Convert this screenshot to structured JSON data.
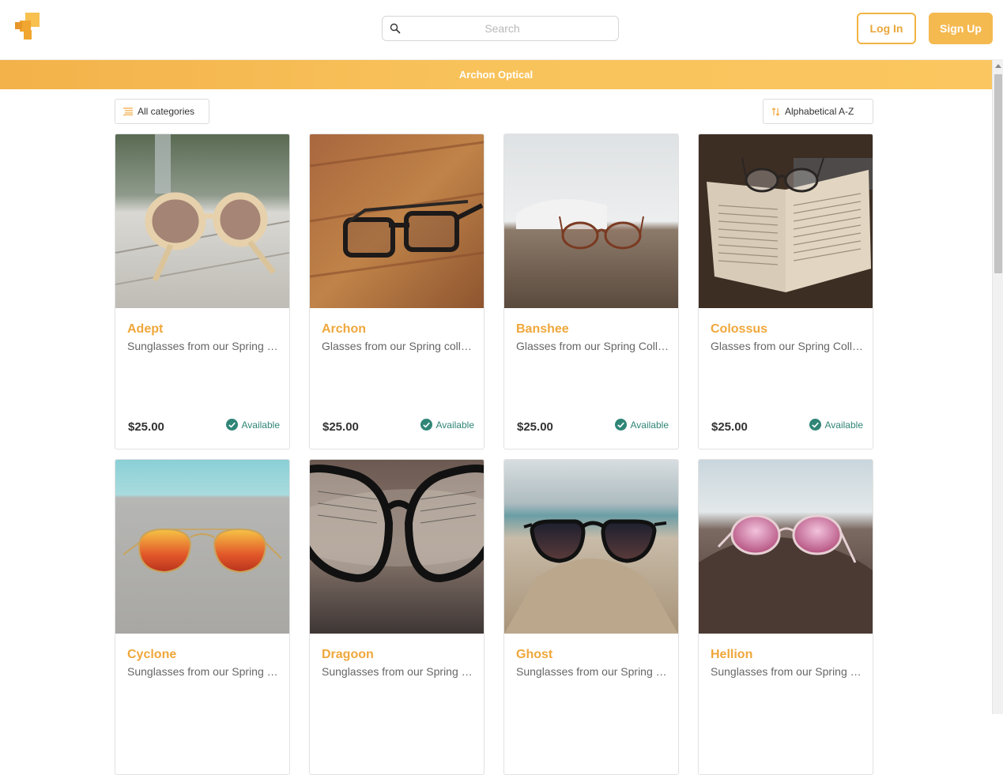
{
  "header": {
    "logo_icon": "logo-icon",
    "search": {
      "placeholder": "Search",
      "value": ""
    },
    "login_label": "Log In",
    "signup_label": "Sign Up"
  },
  "banner": {
    "title": "Archon Optical"
  },
  "filters": {
    "category_label": "All categories",
    "sort_label": "Alphabetical A-Z"
  },
  "colors": {
    "accent": "#f4b94f",
    "accent_text": "#efa73b",
    "available": "#2f8576"
  },
  "products": [
    {
      "name": "Adept",
      "description": "Sunglasses from our Spring collection",
      "price": "$25.00",
      "status": "Available"
    },
    {
      "name": "Archon",
      "description": "Glasses from our Spring collection",
      "price": "$25.00",
      "status": "Available"
    },
    {
      "name": "Banshee",
      "description": "Glasses from our Spring Collection",
      "price": "$25.00",
      "status": "Available"
    },
    {
      "name": "Colossus",
      "description": "Glasses from our Spring Collection",
      "price": "$25.00",
      "status": "Available"
    },
    {
      "name": "Cyclone",
      "description": "Sunglasses from our Spring collection",
      "price": "",
      "status": ""
    },
    {
      "name": "Dragoon",
      "description": "Sunglasses from our Spring collection",
      "price": "",
      "status": ""
    },
    {
      "name": "Ghost",
      "description": "Sunglasses from our Spring collection",
      "price": "",
      "status": ""
    },
    {
      "name": "Hellion",
      "description": "Sunglasses from our Spring collection",
      "price": "",
      "status": ""
    }
  ]
}
